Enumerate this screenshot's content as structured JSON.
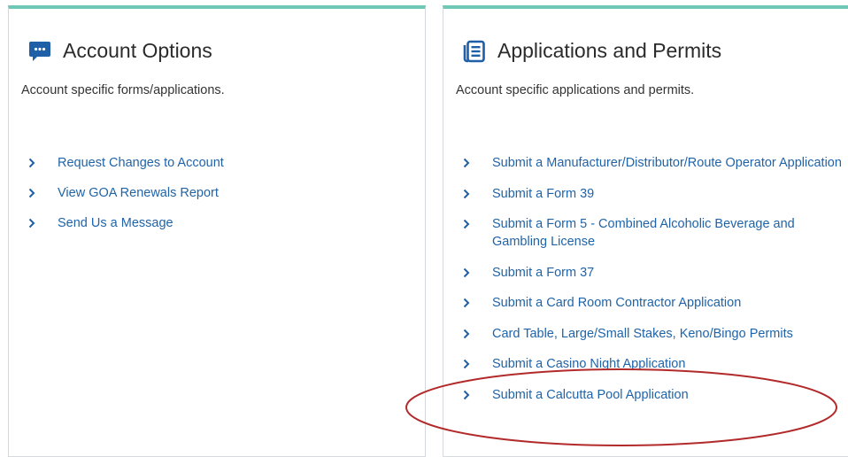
{
  "account_options": {
    "title": "Account Options",
    "description": "Account specific forms/applications.",
    "links": [
      {
        "label": "Request Changes to Account"
      },
      {
        "label": "View GOA Renewals Report"
      },
      {
        "label": "Send Us a Message"
      }
    ]
  },
  "applications_permits": {
    "title": "Applications and Permits",
    "description": "Account specific applications and permits.",
    "links": [
      {
        "label": "Submit a Manufacturer/Distributor/Route Operator Application"
      },
      {
        "label": "Submit a Form 39"
      },
      {
        "label": "Submit a Form 5 - Combined Alcoholic Beverage and Gambling License"
      },
      {
        "label": "Submit a Form 37"
      },
      {
        "label": "Submit a Card Room Contractor Application"
      },
      {
        "label": "Card Table, Large/Small Stakes, Keno/Bingo Permits"
      },
      {
        "label": "Submit a Casino Night Application"
      },
      {
        "label": "Submit a Calcutta Pool Application"
      }
    ]
  },
  "colors": {
    "accent_border": "#6fc7b5",
    "link": "#1f63a8",
    "title_icon": "#1f5fa8",
    "highlight_ellipse": "#b22a2a"
  },
  "icons": {
    "account_title_icon": "chat-bubble-icon",
    "applications_title_icon": "document-list-icon",
    "link_bullet": "chevron-right-icon"
  }
}
